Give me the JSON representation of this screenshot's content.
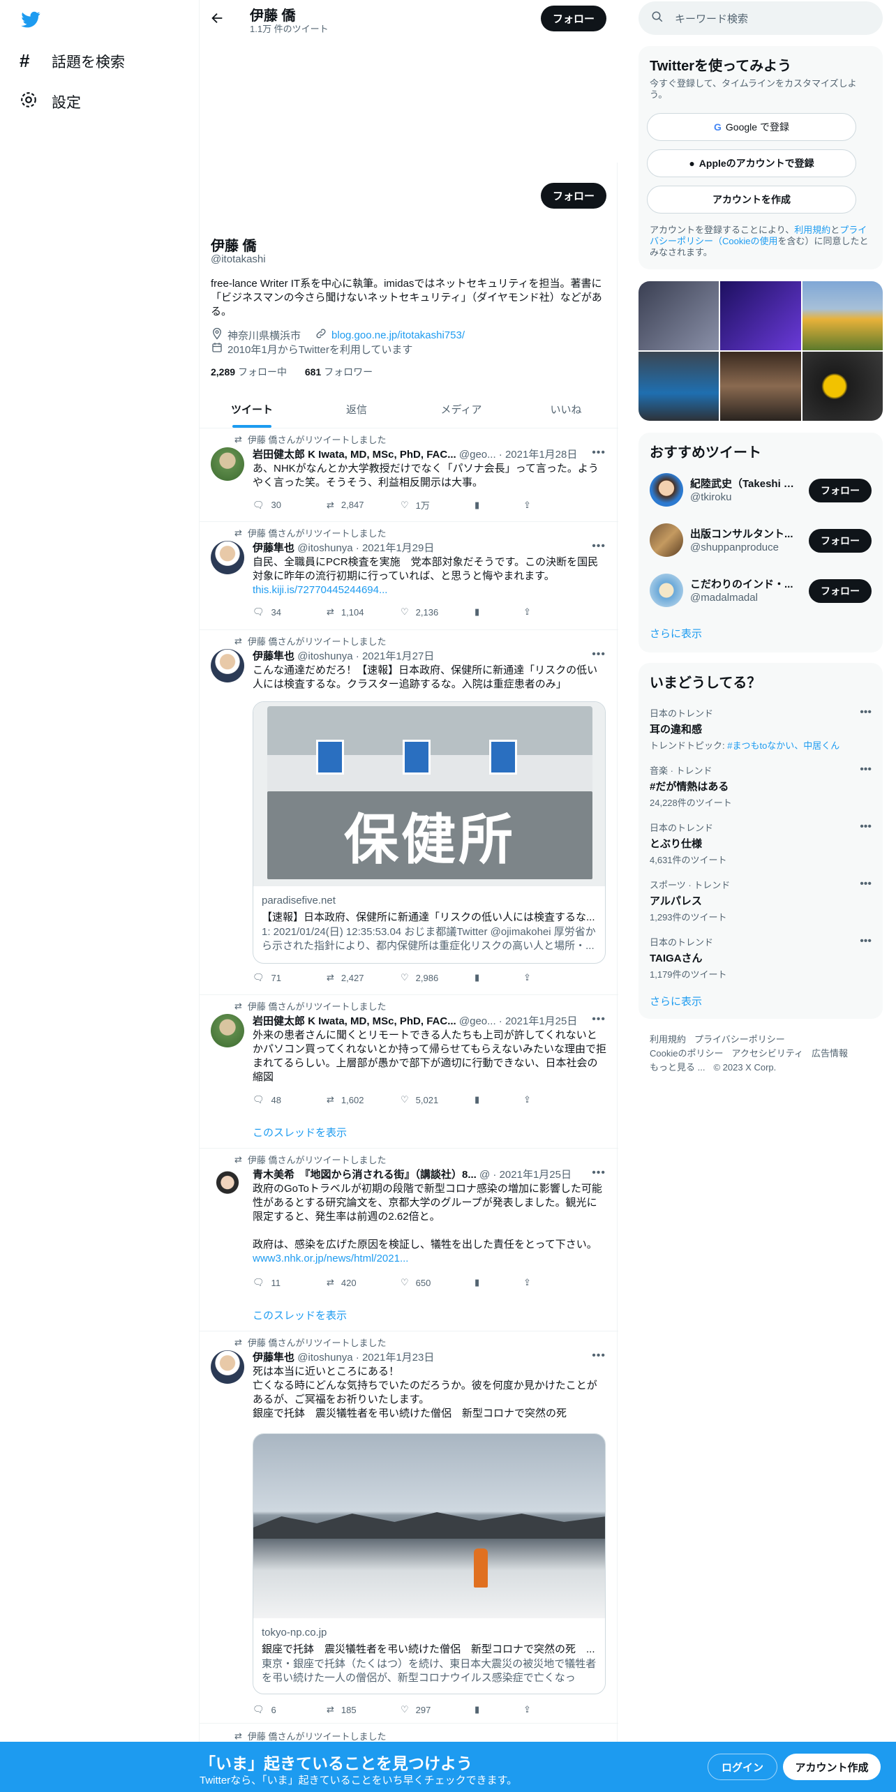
{
  "nav": {
    "explore_label": "話題を検索",
    "settings_label": "設定"
  },
  "header": {
    "name": "伊藤 僑",
    "tweet_count": "1.1万 件のツイート",
    "follow_label": "フォロー"
  },
  "profile": {
    "name": "伊藤 僑",
    "handle": "@itotakashi",
    "follow_label": "フォロー",
    "bio": "free-lance Writer IT系を中心に執筆。imidasではネットセキュリティを担当。著書に「ビジネスマンの今さら聞けないネットセキュリティ」（ダイヤモンド社）などがある。",
    "location": "神奈川県横浜市",
    "website": "blog.goo.ne.jp/itotakashi753/",
    "joined": "2010年1月からTwitterを利用しています",
    "following_count": "2,289",
    "following_label": "フォロー中",
    "followers_count": "681",
    "followers_label": "フォロワー"
  },
  "tabs": [
    {
      "label": "ツイート"
    },
    {
      "label": "返信"
    },
    {
      "label": "メディア"
    },
    {
      "label": "いいね"
    }
  ],
  "retweet_label": "伊藤 僑さんがリツイートしました",
  "thread_label": "このスレッドを表示",
  "tweets": [
    {
      "name": "岩田健太郎 K Iwata, MD, MSc, PhD, FAC...",
      "meta": "@geo... · 2021年1月28日",
      "text": "あ、NHKがなんとか大学教授だけでなく「パソナ会長」って言った。ようやく言った笑。そうそう、利益相反開示は大事。",
      "replies": "30",
      "retweets": "2,847",
      "likes": "1万"
    },
    {
      "name": "伊藤隼也",
      "meta": "@itoshunya · 2021年1月29日",
      "text": "自民、全職員にPCR検査を実施　党本部対象だそうです。この決断を国民対象に昨年の流行初期に行っていれば、と思うと悔やまれます。",
      "link": "this.kiji.is/72770445244694...",
      "replies": "34",
      "retweets": "1,104",
      "likes": "2,136"
    },
    {
      "name": "伊藤隼也",
      "meta": "@itoshunya · 2021年1月27日",
      "text": "こんな通達だめだろ！【速報】日本政府、保健所に新通達「リスクの低い人には検査するな。クラスター追跡するな。入院は重症患者のみ」",
      "card_image_text": "保健所",
      "card_domain": "paradisefive.net",
      "card_title": "【速報】日本政府、保健所に新通達「リスクの低い人には検査するな...",
      "card_desc": "1: 2021/01/24(日) 12:35:53.04 おじま都議Twitter @ojimakohei 厚労省から示された指針により、都内保健所は重症化リスクの高い人と場所・...",
      "replies": "71",
      "retweets": "2,427",
      "likes": "2,986"
    },
    {
      "name": "岩田健太郎 K Iwata, MD, MSc, PhD, FAC...",
      "meta": "@geo... · 2021年1月25日",
      "text": "外来の患者さんに聞くとリモートできる人たちも上司が許してくれないとかパソコン買ってくれないとか持って帰らせてもらえないみたいな理由で拒まれてるらしい。上層部が愚かで部下が適切に行動できない、日本社会の縮図",
      "replies": "48",
      "retweets": "1,602",
      "likes": "5,021"
    },
    {
      "name": "青木美希　『地図から消される街』（講談社）8...",
      "meta": "@ · 2021年1月25日",
      "text": "政府のGoToトラベルが初期の段階で新型コロナ感染の増加に影響した可能性があるとする研究論文を、京都大学のグループが発表しました。観光に限定すると、発生率は前週の2.62倍と。",
      "text2": "政府は、感染を広げた原因を検証し、犠牲を出した責任をとって下さい。",
      "link": "www3.nhk.or.jp/news/html/2021...",
      "replies": "11",
      "retweets": "420",
      "likes": "650"
    },
    {
      "name": "伊藤隼也",
      "meta": "@itoshunya · 2021年1月23日",
      "text": "死は本当に近いところにある！\n亡くなる時にどんな気持ちでいたのだろうか。彼を何度か見かけたことがあるが、ご冥福をお祈りいたします。\n銀座で托鉢　震災犠牲者を弔い続けた僧侶　新型コロナで突然の死",
      "card_domain": "tokyo-np.co.jp",
      "card_title": "銀座で托鉢　震災犠牲者を弔い続けた僧侶　新型コロナで突然の死　...",
      "card_desc": "東京・銀座で托鉢（たくはつ）を続け、東日本大震災の被災地で犠牲者を弔い続けた一人の僧侶が、新型コロナウイルス感染症で亡くなった。...",
      "replies": "6",
      "retweets": "185",
      "likes": "297"
    }
  ],
  "right": {
    "search_placeholder": "キーワード検索",
    "signup_title": "Twitterを使ってみよう",
    "signup_sub": "今すぐ登録して、タイムラインをカスタマイズしよう。",
    "google_label": "Google で登録",
    "apple_label": "Appleのアカウントで登録",
    "create_label": "アカウントを作成",
    "terms_pre": "アカウントを登録することにより、",
    "terms_link1": "利用規約",
    "terms_mid": "と",
    "terms_link2": "プライバシーポリシー（Cookieの使用",
    "terms_post": "を含む）に同意したとみなされます。",
    "rec_title": "おすすめツイート",
    "recs": [
      {
        "name": "紀陸武史（Takeshi K...",
        "handle": "@tkiroku"
      },
      {
        "name": "出版コンサルタント...",
        "handle": "@shuppanproduce"
      },
      {
        "name": "こだわりのインド・...",
        "handle": "@madalmadal"
      }
    ],
    "rec_follow": "フォロー",
    "show_more": "さらに表示",
    "trends_title": "いまどうしてる？",
    "trends": [
      {
        "cat": "日本のトレンド",
        "name": "耳の違和感",
        "extra_pre": "トレンドトピック: ",
        "extra_link": "#まつもtoなかい、中居くん"
      },
      {
        "cat": "音楽 · トレンド",
        "name": "#だが情熱はある",
        "extra": "24,228件のツイート"
      },
      {
        "cat": "日本のトレンド",
        "name": "とぶり仕様",
        "extra": "4,631件のツイート"
      },
      {
        "cat": "スポーツ · トレンド",
        "name": "アルパレス",
        "extra": "1,293件のツイート"
      },
      {
        "cat": "日本のトレンド",
        "name": "TAIGAさん",
        "extra": "1,179件のツイート"
      }
    ],
    "footer": {
      "terms": "利用規約",
      "privacy": "プライバシーポリシー",
      "cookie": "Cookieのポリシー",
      "access": "アクセシビリティ",
      "ads": "広告情報",
      "more": "もっと見る ...",
      "copy": "© 2023 X Corp."
    }
  },
  "bottom": {
    "title": "「いま」起きていることを見つけよう",
    "sub": "Twitterなら、「いま」起きていることをいち早くチェックできます。",
    "login": "ログイン",
    "signup": "アカウント作成"
  },
  "colors": {
    "accent": "#1d9bf0",
    "text": "#0f1419",
    "muted": "#536471",
    "panel": "#f7f9f9"
  }
}
